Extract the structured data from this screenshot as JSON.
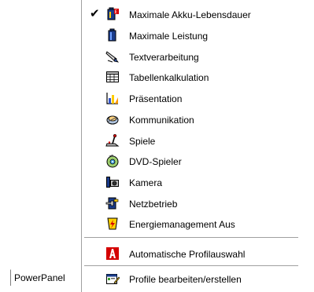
{
  "taskbar": {
    "label": "PowerPanel"
  },
  "menu": {
    "items": [
      {
        "label": "Maximale Akku-Lebensdauer",
        "checked": true,
        "icon": "battery-max-life-icon"
      },
      {
        "label": "Maximale Leistung",
        "checked": false,
        "icon": "battery-performance-icon"
      },
      {
        "label": "Textverarbeitung",
        "checked": false,
        "icon": "pen-text-icon"
      },
      {
        "label": "Tabellenkalkulation",
        "checked": false,
        "icon": "spreadsheet-icon"
      },
      {
        "label": "Präsentation",
        "checked": false,
        "icon": "presentation-chart-icon"
      },
      {
        "label": "Kommunikation",
        "checked": false,
        "icon": "communication-icon"
      },
      {
        "label": "Spiele",
        "checked": false,
        "icon": "joystick-icon"
      },
      {
        "label": "DVD-Spieler",
        "checked": false,
        "icon": "dvd-player-icon"
      },
      {
        "label": "Kamera",
        "checked": false,
        "icon": "camera-icon"
      },
      {
        "label": "Netzbetrieb",
        "checked": false,
        "icon": "power-plug-icon"
      },
      {
        "label": "Energiemanagement Aus",
        "checked": false,
        "icon": "energy-management-off-icon"
      }
    ],
    "auto_item": {
      "label": "Automatische Profilauswahl",
      "icon": "auto-profile-icon"
    },
    "edit_item": {
      "label": "Profile bearbeiten/erstellen",
      "icon": "edit-profiles-icon"
    },
    "check_glyph": "✔"
  }
}
